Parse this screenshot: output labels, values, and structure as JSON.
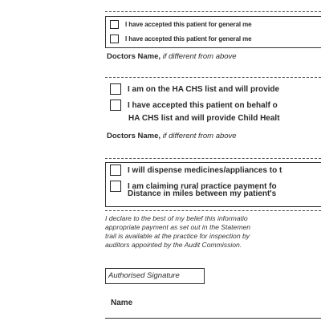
{
  "section1": {
    "items": [
      "I have accepted this patient for general me",
      "I have accepted this patient for general me"
    ],
    "doctor_label": "Doctors Name,",
    "doctor_note": "if different from above"
  },
  "section2": {
    "item1": "I am on the HA CHS list and will provide",
    "item2_line1": "I have accepted this patient on behalf o",
    "item2_line2": "HA CHS list and will provide Child Healt",
    "doctor_label": "Doctors Name,",
    "doctor_note": "if different from above"
  },
  "section3": {
    "item1": "I will dispense medicines/appliances to t",
    "item2_line1": "I am claiming rural practice payment fo",
    "item2_line2": "Distance in miles between my patient's"
  },
  "declaration": {
    "lines": [
      "I declare to the best of my belief this informatio",
      "appropriate payment as set out in the Statemen",
      "trail is available at the practice for inspection by",
      "auditors appointed by the Audit Commission."
    ]
  },
  "signature_label": "Authorised Signature",
  "name_label": "Name"
}
